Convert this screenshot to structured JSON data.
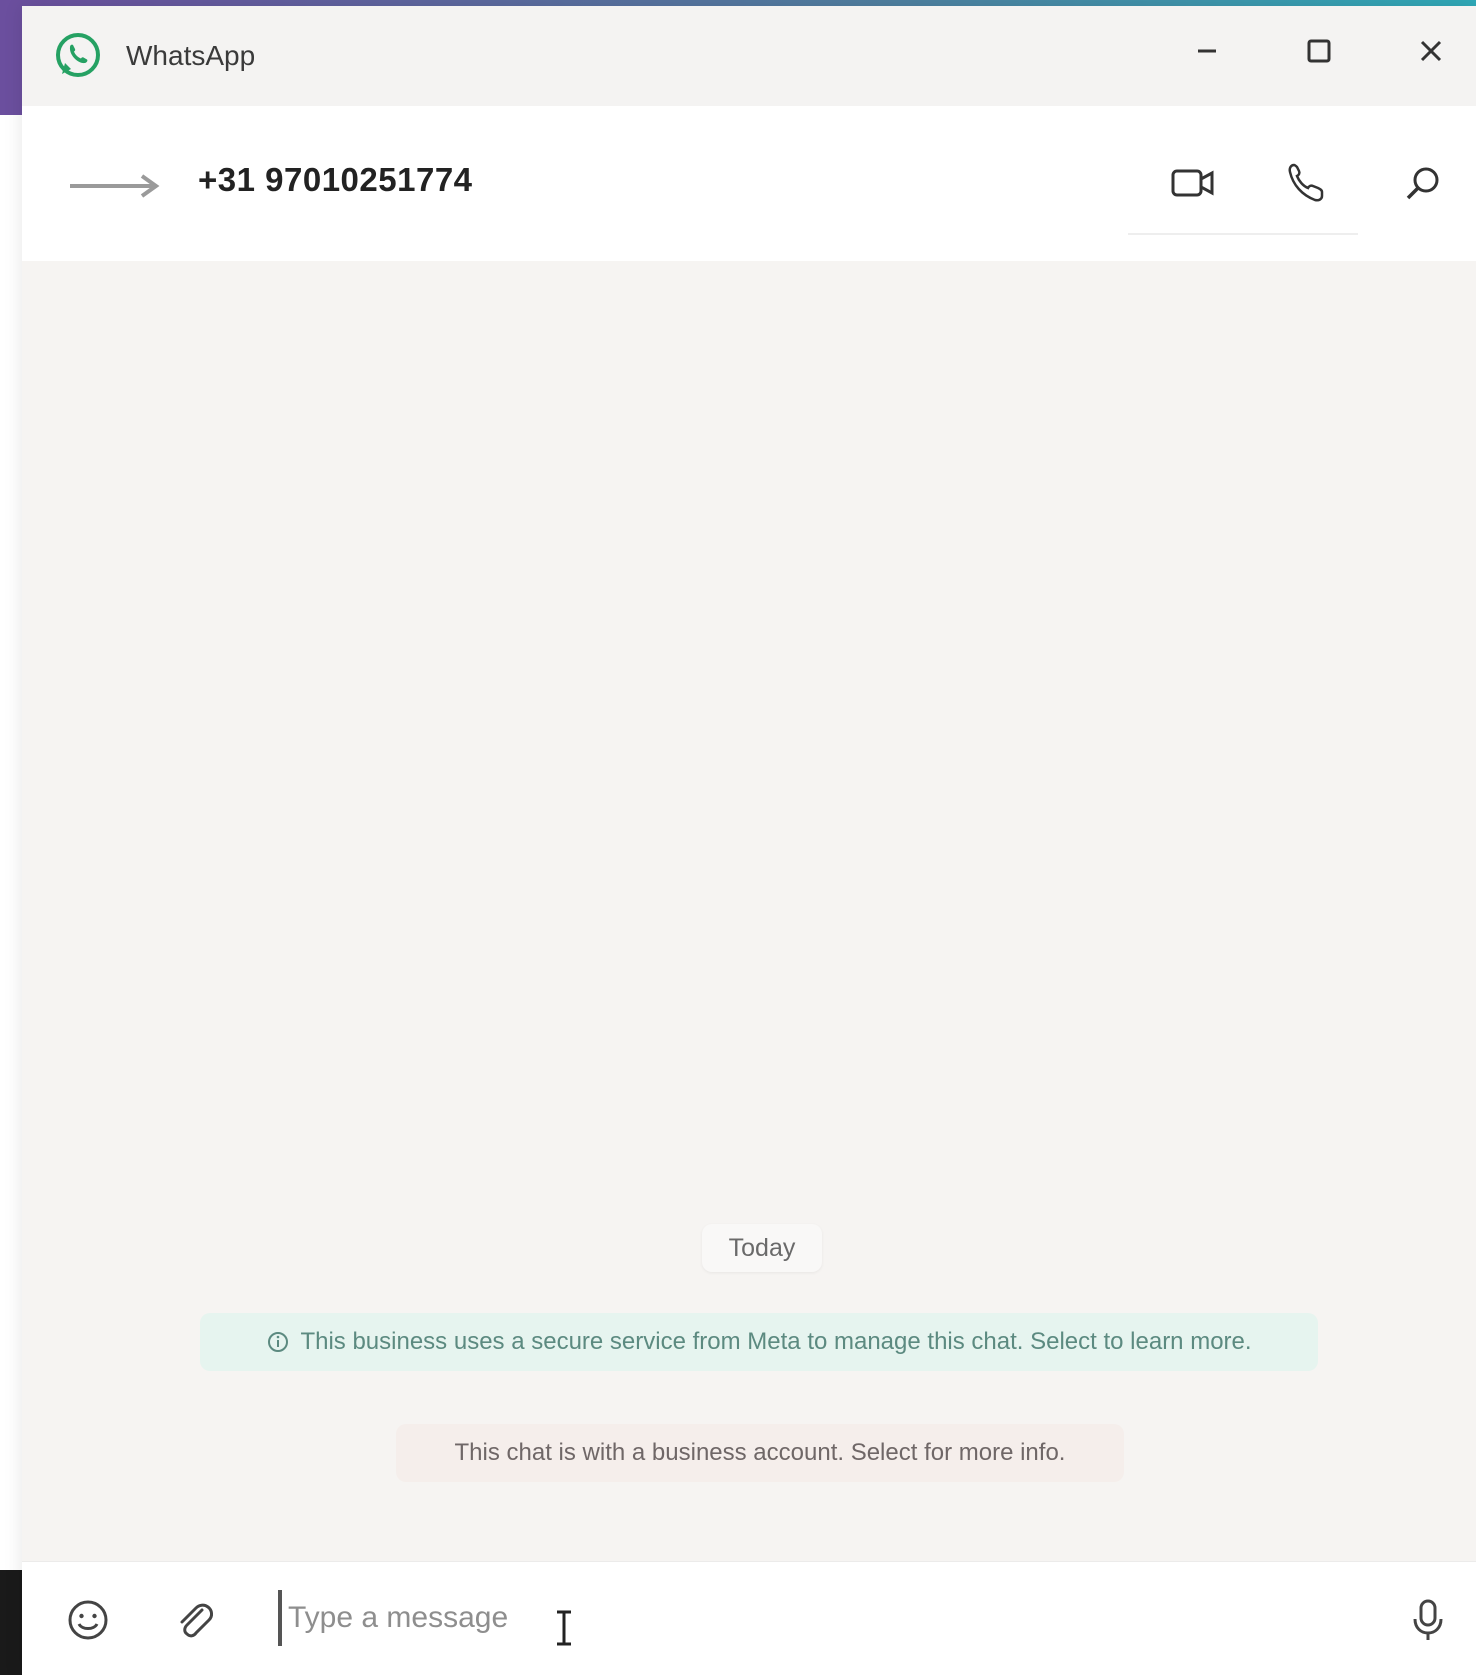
{
  "window": {
    "app_title": "WhatsApp",
    "controls": {
      "minimize": "minimize-icon",
      "maximize": "maximize-icon",
      "close": "close-icon"
    }
  },
  "chat_header": {
    "contact_name": "+31 97010251774",
    "icons": [
      "back-arrow-icon",
      "video-call-icon",
      "phone-icon",
      "search-icon"
    ]
  },
  "messages": {
    "date_chip": "Today",
    "meta_notice": "This business uses a secure service from Meta to manage this chat. Select to learn more.",
    "business_notice": "This chat is with a business account. Select for more info."
  },
  "composer": {
    "placeholder": "Type a message",
    "icons": [
      "emoji-icon",
      "attach-icon",
      "microphone-icon"
    ]
  },
  "colors": {
    "brand_green": "#25a163",
    "notice_bg": "#e6f4ef",
    "notice_text": "#5c8a80",
    "business_bg": "#f5eeeb"
  }
}
